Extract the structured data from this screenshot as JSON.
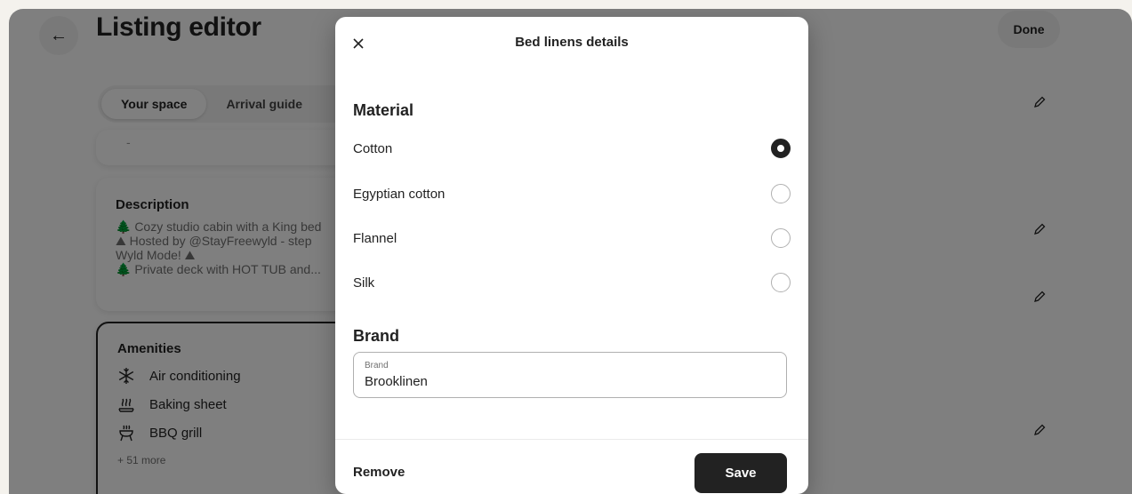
{
  "editor": {
    "title": "Listing editor",
    "done_label": "Done",
    "tabs": [
      {
        "label": "Your space",
        "active": true
      },
      {
        "label": "Arrival guide",
        "active": false
      }
    ],
    "top_card_text": "-",
    "description": {
      "title": "Description",
      "lines": [
        "🌲 Cozy studio cabin with a King bed",
        "⛰ Hosted by @StayFreewyld - step",
        "Wyld Mode! ⛰",
        "🌲 Private deck with HOT TUB and..."
      ]
    },
    "amenities": {
      "title": "Amenities",
      "items": [
        {
          "label": "Air conditioning",
          "icon": "snowflake-icon"
        },
        {
          "label": "Baking sheet",
          "icon": "baking-sheet-icon"
        },
        {
          "label": "BBQ grill",
          "icon": "bbq-grill-icon"
        }
      ],
      "more": "+ 51 more"
    }
  },
  "modal": {
    "title": "Bed linens details",
    "material": {
      "heading": "Material",
      "options": [
        {
          "label": "Cotton",
          "selected": true
        },
        {
          "label": "Egyptian cotton",
          "selected": false
        },
        {
          "label": "Flannel",
          "selected": false
        },
        {
          "label": "Silk",
          "selected": false
        }
      ]
    },
    "brand": {
      "heading": "Brand",
      "field_label": "Brand",
      "value": "Brooklinen"
    },
    "remove_label": "Remove",
    "save_label": "Save"
  },
  "colors": {
    "primary_dark": "#222222",
    "overlay": "rgba(0,0,0,0.5)"
  }
}
